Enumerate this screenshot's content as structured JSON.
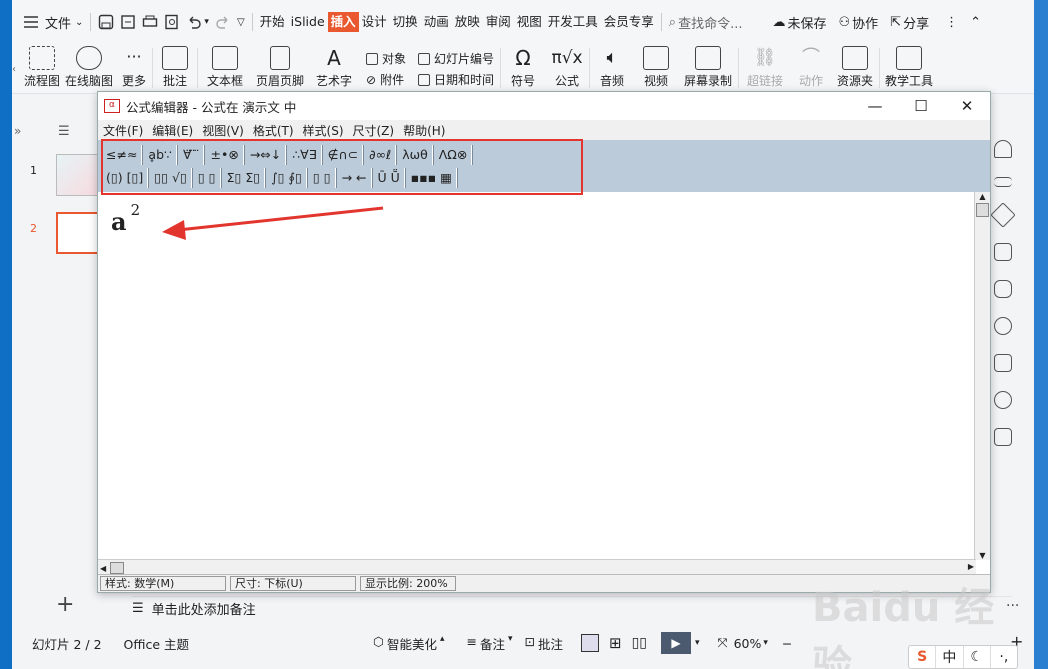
{
  "topbar": {
    "file_menu": "文件",
    "tabs": [
      "开始",
      "iSlide",
      "插入",
      "设计",
      "切换",
      "动画",
      "放映",
      "审阅",
      "视图",
      "开发工具",
      "会员专享"
    ],
    "active_tab": "插入",
    "search_placeholder": "查找命令...",
    "unsaved": "未保存",
    "collab": "协作",
    "share": "分享"
  },
  "ribbon": {
    "buttons": [
      "流程图",
      "在线脑图",
      "更多",
      "批注",
      "文本框",
      "页眉页脚",
      "艺术字"
    ],
    "col1": [
      "对象",
      "附件"
    ],
    "col2": [
      "幻灯片编号",
      "日期和时间"
    ],
    "buttons2": [
      "符号",
      "公式",
      "音频",
      "视频",
      "屏幕录制",
      "超链接",
      "动作",
      "资源夹",
      "教学工具"
    ]
  },
  "slides": [
    "1",
    "2"
  ],
  "dialog": {
    "title": "公式编辑器 - 公式在 演示文 中",
    "menu": [
      "文件(F)",
      "编辑(E)",
      "视图(V)",
      "格式(T)",
      "样式(S)",
      "尺寸(Z)",
      "帮助(H)"
    ],
    "toolbar_row1": [
      "≤≠≈",
      "ḁb∵",
      "∀̈ ̈ ̈",
      "±•⊗",
      "→⇔↓",
      "∴∀∃",
      "∉∩⊂",
      "∂∞ℓ",
      "λωθ",
      "ΛΩ⊗"
    ],
    "toolbar_row2": [
      "(▯) [▯]",
      "▯▯ √▯",
      "▯ ▯",
      "Σ▯ Σ▯",
      "∫▯ ∮▯",
      "▯ ▯",
      "→ ←",
      "Ū Ṻ",
      "▪▪▪ ▦"
    ],
    "equation_base": "a",
    "equation_exp": "2",
    "status_style": "样式: 数学(M)",
    "status_size": "尺寸: 下标(U)",
    "status_zoom": "显示比例: 200%"
  },
  "notes_placeholder": "单击此处添加备注",
  "status": {
    "slide_info": "幻灯片 2 / 2",
    "theme": "Office 主题",
    "beautify": "智能美化",
    "notes": "备注",
    "comment": "批注",
    "zoom": "60%"
  },
  "watermark": "Baidu 经验",
  "ime": [
    "S",
    "中"
  ],
  "colors": {
    "accent": "#e9582e",
    "highlight": "#e2352e",
    "toolbar_bg": "#bccbd9"
  }
}
